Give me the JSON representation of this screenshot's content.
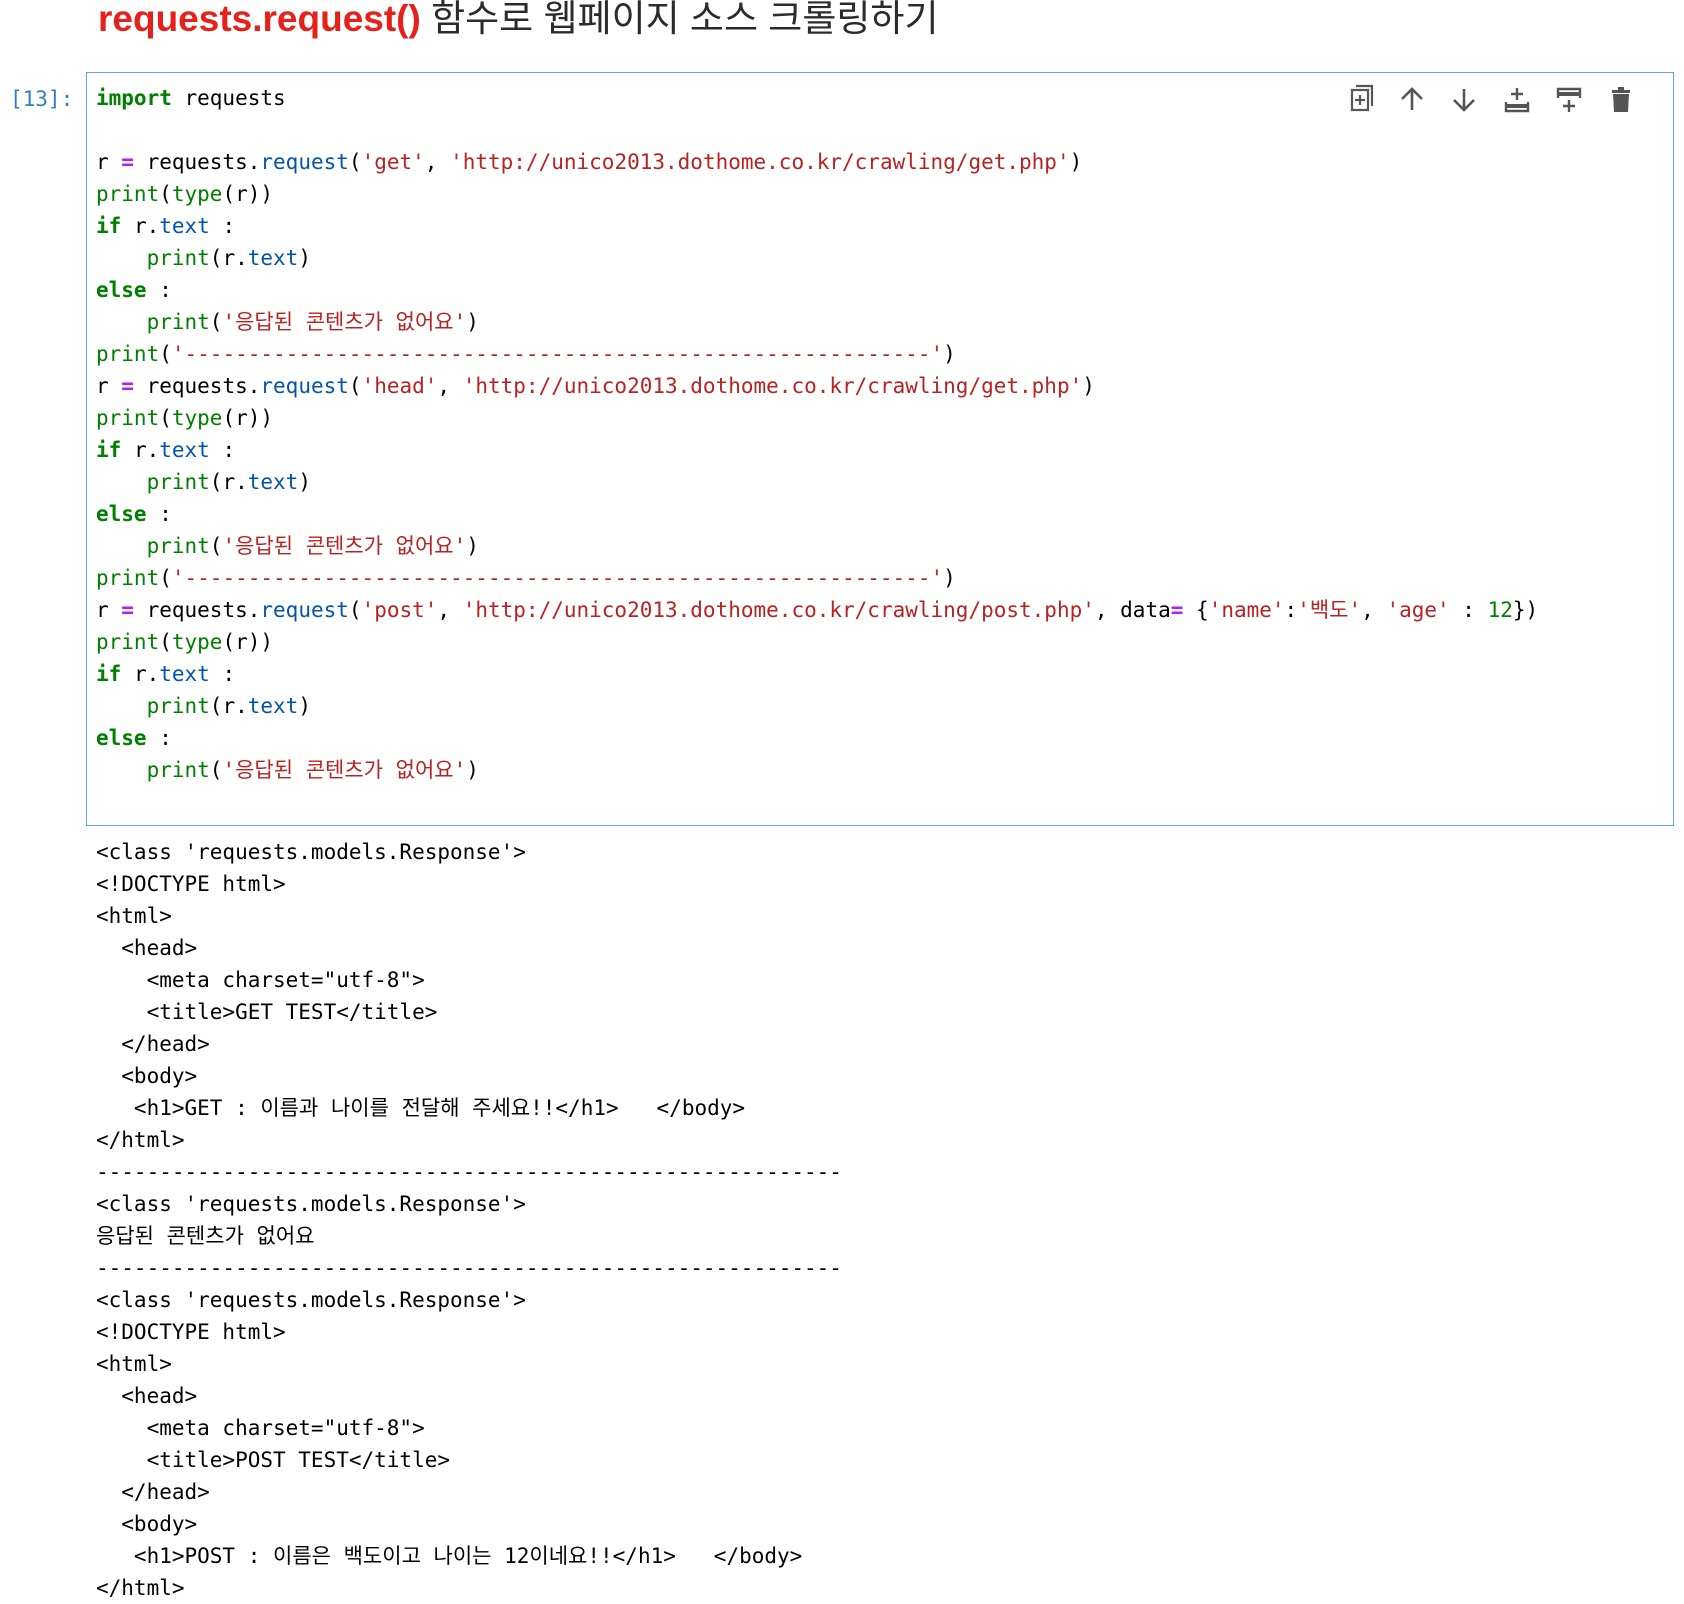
{
  "heading": {
    "function_name": "requests.request()",
    "description": " 함수로 웹페이지 소스 크롤링하기"
  },
  "cell": {
    "prompt": "[13]:",
    "code_lines": [
      [
        [
          "kw",
          "import"
        ],
        [
          "plain",
          " requests"
        ]
      ],
      [],
      [
        [
          "plain",
          "r "
        ],
        [
          "op",
          "="
        ],
        [
          "plain",
          " requests."
        ],
        [
          "attr",
          "request"
        ],
        [
          "plain",
          "("
        ],
        [
          "str",
          "'get'"
        ],
        [
          "plain",
          ", "
        ],
        [
          "str",
          "'http://unico2013.dothome.co.kr/crawling/get.php'"
        ],
        [
          "plain",
          ")"
        ]
      ],
      [
        [
          "bi",
          "print"
        ],
        [
          "plain",
          "("
        ],
        [
          "bi",
          "type"
        ],
        [
          "plain",
          "(r))"
        ]
      ],
      [
        [
          "kw",
          "if"
        ],
        [
          "plain",
          " r."
        ],
        [
          "attr",
          "text"
        ],
        [
          "plain",
          " :"
        ]
      ],
      [
        [
          "plain",
          "    "
        ],
        [
          "bi",
          "print"
        ],
        [
          "plain",
          "(r."
        ],
        [
          "attr",
          "text"
        ],
        [
          "plain",
          ")"
        ]
      ],
      [
        [
          "kw",
          "else"
        ],
        [
          "plain",
          " :"
        ]
      ],
      [
        [
          "plain",
          "    "
        ],
        [
          "bi",
          "print"
        ],
        [
          "plain",
          "("
        ],
        [
          "str",
          "'응답된 콘텐츠가 없어요'"
        ],
        [
          "plain",
          ")"
        ]
      ],
      [
        [
          "bi",
          "print"
        ],
        [
          "plain",
          "("
        ],
        [
          "str",
          "'-----------------------------------------------------------'"
        ],
        [
          "plain",
          ")"
        ]
      ],
      [
        [
          "plain",
          "r "
        ],
        [
          "op",
          "="
        ],
        [
          "plain",
          " requests."
        ],
        [
          "attr",
          "request"
        ],
        [
          "plain",
          "("
        ],
        [
          "str",
          "'head'"
        ],
        [
          "plain",
          ", "
        ],
        [
          "str",
          "'http://unico2013.dothome.co.kr/crawling/get.php'"
        ],
        [
          "plain",
          ")"
        ]
      ],
      [
        [
          "bi",
          "print"
        ],
        [
          "plain",
          "("
        ],
        [
          "bi",
          "type"
        ],
        [
          "plain",
          "(r))"
        ]
      ],
      [
        [
          "kw",
          "if"
        ],
        [
          "plain",
          " r."
        ],
        [
          "attr",
          "text"
        ],
        [
          "plain",
          " :"
        ]
      ],
      [
        [
          "plain",
          "    "
        ],
        [
          "bi",
          "print"
        ],
        [
          "plain",
          "(r."
        ],
        [
          "attr",
          "text"
        ],
        [
          "plain",
          ")"
        ]
      ],
      [
        [
          "kw",
          "else"
        ],
        [
          "plain",
          " :"
        ]
      ],
      [
        [
          "plain",
          "    "
        ],
        [
          "bi",
          "print"
        ],
        [
          "plain",
          "("
        ],
        [
          "str",
          "'응답된 콘텐츠가 없어요'"
        ],
        [
          "plain",
          ")"
        ]
      ],
      [
        [
          "bi",
          "print"
        ],
        [
          "plain",
          "("
        ],
        [
          "str",
          "'-----------------------------------------------------------'"
        ],
        [
          "plain",
          ")"
        ]
      ],
      [
        [
          "plain",
          "r "
        ],
        [
          "op",
          "="
        ],
        [
          "plain",
          " requests."
        ],
        [
          "attr",
          "request"
        ],
        [
          "plain",
          "("
        ],
        [
          "str",
          "'post'"
        ],
        [
          "plain",
          ", "
        ],
        [
          "str",
          "'http://unico2013.dothome.co.kr/crawling/post.php'"
        ],
        [
          "plain",
          ", data"
        ],
        [
          "op",
          "="
        ],
        [
          "plain",
          " {"
        ],
        [
          "str",
          "'name'"
        ],
        [
          "plain",
          ":"
        ],
        [
          "str",
          "'백도'"
        ],
        [
          "plain",
          ", "
        ],
        [
          "str",
          "'age'"
        ],
        [
          "plain",
          " : "
        ],
        [
          "num",
          "12"
        ],
        [
          "plain",
          "})"
        ]
      ],
      [
        [
          "bi",
          "print"
        ],
        [
          "plain",
          "("
        ],
        [
          "bi",
          "type"
        ],
        [
          "plain",
          "(r))"
        ]
      ],
      [
        [
          "kw",
          "if"
        ],
        [
          "plain",
          " r."
        ],
        [
          "attr",
          "text"
        ],
        [
          "plain",
          " :"
        ]
      ],
      [
        [
          "plain",
          "    "
        ],
        [
          "bi",
          "print"
        ],
        [
          "plain",
          "(r."
        ],
        [
          "attr",
          "text"
        ],
        [
          "plain",
          ")"
        ]
      ],
      [
        [
          "kw",
          "else"
        ],
        [
          "plain",
          " :"
        ]
      ],
      [
        [
          "plain",
          "    "
        ],
        [
          "bi",
          "print"
        ],
        [
          "plain",
          "("
        ],
        [
          "str",
          "'응답된 콘텐츠가 없어요'"
        ],
        [
          "plain",
          ")"
        ]
      ]
    ]
  },
  "toolbar": {
    "buttons": [
      {
        "name": "duplicate-cell-button",
        "icon": "copy-icon"
      },
      {
        "name": "move-cell-up-button",
        "icon": "arrow-up-icon"
      },
      {
        "name": "move-cell-down-button",
        "icon": "arrow-down-icon"
      },
      {
        "name": "insert-cell-above-button",
        "icon": "insert-above-icon"
      },
      {
        "name": "insert-cell-below-button",
        "icon": "insert-below-icon"
      },
      {
        "name": "delete-cell-button",
        "icon": "trash-icon"
      }
    ]
  },
  "output": {
    "lines": [
      "<class 'requests.models.Response'>",
      "<!DOCTYPE html>",
      "<html>",
      "  <head>",
      "    <meta charset=\"utf-8\">",
      "    <title>GET TEST</title>",
      "  </head>",
      "  <body>",
      "   <h1>GET : 이름과 나이를 전달해 주세요!!</h1>   </body>",
      "</html>",
      "-----------------------------------------------------------",
      "<class 'requests.models.Response'>",
      "응답된 콘텐츠가 없어요",
      "-----------------------------------------------------------",
      "<class 'requests.models.Response'>",
      "<!DOCTYPE html>",
      "<html>",
      "  <head>",
      "    <meta charset=\"utf-8\">",
      "    <title>POST TEST</title>",
      "  </head>",
      "  <body>",
      "   <h1>POST : 이름은 백도이고 나이는 12이네요!!</h1>   </body>",
      "</html>"
    ]
  },
  "colors": {
    "heading_function": "#e8201a",
    "keyword": "#008000",
    "string": "#ba2121",
    "attribute": "#0055aa",
    "operator": "#aa22ff",
    "cell_border": "#63a6d9",
    "prompt": "#307fc1"
  }
}
